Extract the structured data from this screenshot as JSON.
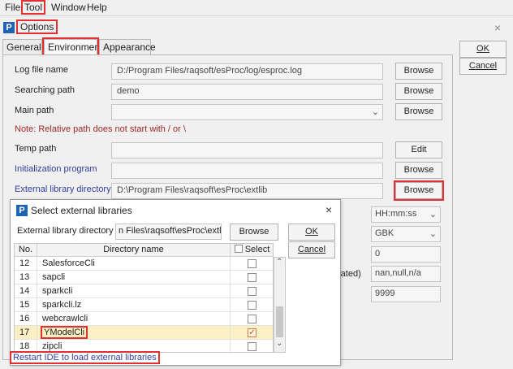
{
  "menu": {
    "file": "File",
    "tool": "Tool",
    "window": "Window",
    "help": "Help"
  },
  "options_dialog": {
    "title": "Options",
    "close": "×",
    "tabs": [
      "General",
      "Environment",
      "Appearance"
    ],
    "ok": "OK",
    "cancel": "Cancel",
    "log_file_name": {
      "label": "Log file name",
      "value": "D:/Program Files/raqsoft/esProc/log/esproc.log",
      "button": "Browse"
    },
    "searching_path": {
      "label": "Searching path",
      "value": "demo",
      "button": "Browse"
    },
    "main_path": {
      "label": "Main path",
      "value": "",
      "button": "Browse"
    },
    "note": "Note: Relative path does not start with / or \\",
    "temp_path": {
      "label": "Temp path",
      "value": "",
      "button": "Edit"
    },
    "init_program": {
      "label": "Initialization program",
      "value": "",
      "button": "Browse"
    },
    "ext_lib_dir": {
      "label": "External library directory",
      "value": "D:\\Program Files\\raqsoft\\esProc\\extlib",
      "button": "Browse"
    },
    "side_fields": {
      "time_format": "HH:mm:ss",
      "charset": "GBK",
      "field3": "0",
      "partial_label": "rated)",
      "null_strings": "nan,null,n/a",
      "field5": "9999"
    }
  },
  "ext_dialog": {
    "title": "Select external libraries",
    "close": "×",
    "dir_label": "External library directory",
    "dir_value": "n Files\\raqsoft\\esProc\\extlib",
    "browse": "Browse",
    "ok": "OK",
    "cancel": "Cancel",
    "columns": {
      "no": "No.",
      "name": "Directory name",
      "select": "Select"
    },
    "rows": [
      {
        "no": "12",
        "name": "SalesforceCli",
        "checked": false
      },
      {
        "no": "13",
        "name": "sapcli",
        "checked": false
      },
      {
        "no": "14",
        "name": "sparkcli",
        "checked": false
      },
      {
        "no": "15",
        "name": "sparkcli.lz",
        "checked": false
      },
      {
        "no": "16",
        "name": "webcrawlcli",
        "checked": false
      },
      {
        "no": "17",
        "name": "YModelCli",
        "checked": true
      },
      {
        "no": "18",
        "name": "zipcli",
        "checked": false
      }
    ],
    "restart_note": "Restart IDE to load external libraries",
    "check_mark": "✓"
  },
  "colors": {
    "highlight": "#e03030",
    "selected_row": "#fbf0c4",
    "link_blue": "#3040a0",
    "note_red": "#a02828",
    "logo_blue": "#1e64b4"
  }
}
